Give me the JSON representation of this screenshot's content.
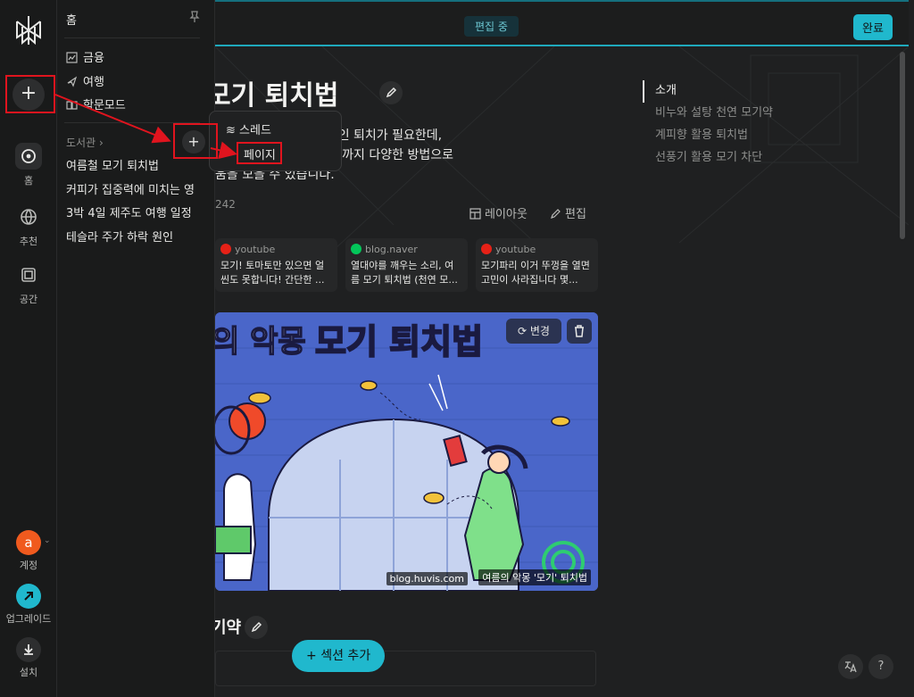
{
  "rail": {
    "items": [
      {
        "label": "홈"
      },
      {
        "label": "추천"
      },
      {
        "label": "공간"
      }
    ],
    "account_initial": "a",
    "account_label": "계정",
    "upgrade_label": "업그레이드",
    "install_label": "설치"
  },
  "sidebar": {
    "title": "홈",
    "links": [
      {
        "label": "금융",
        "icon": "chart-icon"
      },
      {
        "label": "여행",
        "icon": "plane-icon"
      },
      {
        "label": "학문모드",
        "icon": "book-icon"
      }
    ],
    "library_heading": "도서관",
    "library_items": [
      "여름철 모기 퇴치법",
      "커피가 집중력에 미치는 영",
      "3박 4일 제주도 여행 일정",
      "테슬라 주가 하락 원인"
    ]
  },
  "popup": {
    "thread_label": "스레드",
    "page_label": "페이지"
  },
  "topbar": {
    "editing_label": "편집 중",
    "done_label": "완료"
  },
  "page": {
    "title": "모기 퇴치법",
    "lead_lines": [
      "유발하기 때문에 효과적인 퇴치가 필요한데,",
      "양파껍질, 선풍기 활용법까지 다양한 방법으로",
      "움을 모을 수 있습니다."
    ],
    "views": "242",
    "layout_label": "레이아웃",
    "edit_label": "편집",
    "toc": [
      "소개",
      "비누와 설탕 천연 모기약",
      "계피향 활용 퇴치법",
      "선풍기 활용 모기 차단"
    ],
    "sources": [
      {
        "domain": "youtube",
        "text": "모기! 토마토만 있으면 얼씬도 못합니다! 간단한 ...",
        "color": "#e62117"
      },
      {
        "domain": "blog.naver",
        "text": "열대야를 깨우는 소리, 여름 모기 퇴치법 (천연 모...",
        "color": "#03c75a"
      },
      {
        "domain": "youtube",
        "text": "모기파리 이거 뚜껑을 열면 고민이 사라집니다 몇...",
        "color": "#e62117"
      }
    ],
    "hero": {
      "headline_a": "의 악몽",
      "headline_b": "모기 퇴치법",
      "caption_site": "blog.huvis.com",
      "caption_title": "여름의 악몽 '모기' 퇴치법",
      "change_label": "변경"
    },
    "section_title": "기약",
    "add_section_label": "섹션 추가",
    "help_label": "?"
  },
  "colors": {
    "accent": "#20b8cd",
    "highlight": "#e0141e",
    "background": "#1f2021"
  }
}
